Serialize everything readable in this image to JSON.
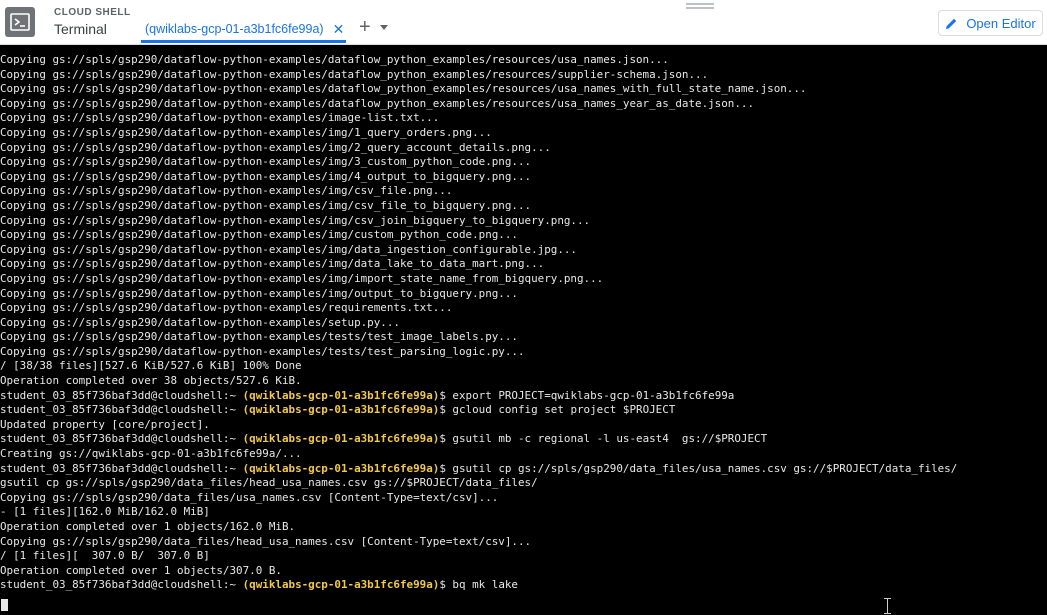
{
  "header": {
    "kicker": "CLOUD SHELL",
    "title": "Terminal",
    "tab_label": "(qwiklabs-gcp-01-a3b1fc6fe99a)",
    "tab_close": "✕",
    "add_tab": "+",
    "open_editor": "Open Editor"
  },
  "colors": {
    "accent": "#1a73e8",
    "terminal_bg": "#000000",
    "terminal_text": "#e8e8e8",
    "project_highlight": "#f2c94c"
  },
  "terminal": {
    "lines": [
      {
        "text": "Copying gs://spls/gsp290/dataflow-python-examples/dataflow_python_examples/resources/usa_names.json..."
      },
      {
        "text": "Copying gs://spls/gsp290/dataflow-python-examples/dataflow_python_examples/resources/supplier-schema.json..."
      },
      {
        "text": "Copying gs://spls/gsp290/dataflow-python-examples/dataflow_python_examples/resources/usa_names_with_full_state_name.json..."
      },
      {
        "text": "Copying gs://spls/gsp290/dataflow-python-examples/dataflow_python_examples/resources/usa_names_year_as_date.json..."
      },
      {
        "text": "Copying gs://spls/gsp290/dataflow-python-examples/image-list.txt..."
      },
      {
        "text": "Copying gs://spls/gsp290/dataflow-python-examples/img/1_query_orders.png..."
      },
      {
        "text": "Copying gs://spls/gsp290/dataflow-python-examples/img/2_query_account_details.png..."
      },
      {
        "text": "Copying gs://spls/gsp290/dataflow-python-examples/img/3_custom_python_code.png..."
      },
      {
        "text": "Copying gs://spls/gsp290/dataflow-python-examples/img/4_output_to_bigquery.png..."
      },
      {
        "text": "Copying gs://spls/gsp290/dataflow-python-examples/img/csv_file.png..."
      },
      {
        "text": "Copying gs://spls/gsp290/dataflow-python-examples/img/csv_file_to_bigquery.png..."
      },
      {
        "text": "Copying gs://spls/gsp290/dataflow-python-examples/img/csv_join_bigquery_to_bigquery.png..."
      },
      {
        "text": "Copying gs://spls/gsp290/dataflow-python-examples/img/custom_python_code.png..."
      },
      {
        "text": "Copying gs://spls/gsp290/dataflow-python-examples/img/data_ingestion_configurable.jpg..."
      },
      {
        "text": "Copying gs://spls/gsp290/dataflow-python-examples/img/data_lake_to_data_mart.png..."
      },
      {
        "text": "Copying gs://spls/gsp290/dataflow-python-examples/img/import_state_name_from_bigquery.png..."
      },
      {
        "text": "Copying gs://spls/gsp290/dataflow-python-examples/img/output_to_bigquery.png..."
      },
      {
        "text": "Copying gs://spls/gsp290/dataflow-python-examples/requirements.txt..."
      },
      {
        "text": "Copying gs://spls/gsp290/dataflow-python-examples/setup.py..."
      },
      {
        "text": "Copying gs://spls/gsp290/dataflow-python-examples/tests/test_image_labels.py..."
      },
      {
        "text": "Copying gs://spls/gsp290/dataflow-python-examples/tests/test_parsing_logic.py..."
      },
      {
        "text": "/ [38/38 files][527.6 KiB/527.6 KiB] 100% Done"
      },
      {
        "text": "Operation completed over 38 objects/527.6 KiB."
      },
      {
        "prompt": "student_03_85f736baf3dd@cloudshell:~ ",
        "project": "(qwiklabs-gcp-01-a3b1fc6fe99a)",
        "cmd": "$ export PROJECT=qwiklabs-gcp-01-a3b1fc6fe99a"
      },
      {
        "prompt": "student_03_85f736baf3dd@cloudshell:~ ",
        "project": "(qwiklabs-gcp-01-a3b1fc6fe99a)",
        "cmd": "$ gcloud config set project $PROJECT"
      },
      {
        "text": "Updated property [core/project]."
      },
      {
        "prompt": "student_03_85f736baf3dd@cloudshell:~ ",
        "project": "(qwiklabs-gcp-01-a3b1fc6fe99a)",
        "cmd": "$ gsutil mb -c regional -l us-east4  gs://$PROJECT"
      },
      {
        "text": "Creating gs://qwiklabs-gcp-01-a3b1fc6fe99a/..."
      },
      {
        "prompt": "student_03_85f736baf3dd@cloudshell:~ ",
        "project": "(qwiklabs-gcp-01-a3b1fc6fe99a)",
        "cmd": "$ gsutil cp gs://spls/gsp290/data_files/usa_names.csv gs://$PROJECT/data_files/"
      },
      {
        "text": "gsutil cp gs://spls/gsp290/data_files/head_usa_names.csv gs://$PROJECT/data_files/"
      },
      {
        "text": "Copying gs://spls/gsp290/data_files/usa_names.csv [Content-Type=text/csv]..."
      },
      {
        "text": "- [1 files][162.0 MiB/162.0 MiB]"
      },
      {
        "text": "Operation completed over 1 objects/162.0 MiB."
      },
      {
        "text": "Copying gs://spls/gsp290/data_files/head_usa_names.csv [Content-Type=text/csv]..."
      },
      {
        "text": "/ [1 files][  307.0 B/  307.0 B]"
      },
      {
        "text": "Operation completed over 1 objects/307.0 B."
      },
      {
        "prompt": "student_03_85f736baf3dd@cloudshell:~ ",
        "project": "(qwiklabs-gcp-01-a3b1fc6fe99a)",
        "cmd": "$ bq mk lake"
      }
    ]
  }
}
